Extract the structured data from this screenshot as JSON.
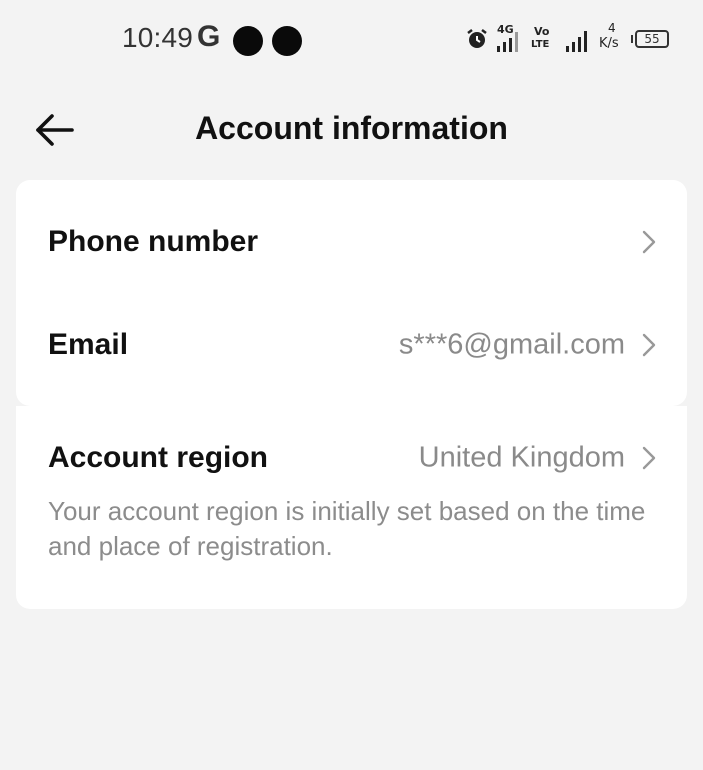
{
  "status_bar": {
    "time": "10:49",
    "carrier_icon": "G",
    "network_1": "4G",
    "network_2_top": "Vo",
    "network_2_bottom": "LTE",
    "speed_value": "4",
    "speed_unit": "K/s",
    "battery_level": "55"
  },
  "header": {
    "title": "Account information",
    "back_icon": "arrow-left-icon"
  },
  "account_rows": [
    {
      "label": "Phone number",
      "value": ""
    },
    {
      "label": "Email",
      "value": "s***6@gmail.com"
    }
  ],
  "region": {
    "label": "Account region",
    "value": "United Kingdom",
    "description": "Your account region is initially set based on the time and place of registration."
  },
  "colors": {
    "background": "#f3f3f3",
    "card": "#ffffff",
    "secondary_text": "#8a8a8a"
  }
}
